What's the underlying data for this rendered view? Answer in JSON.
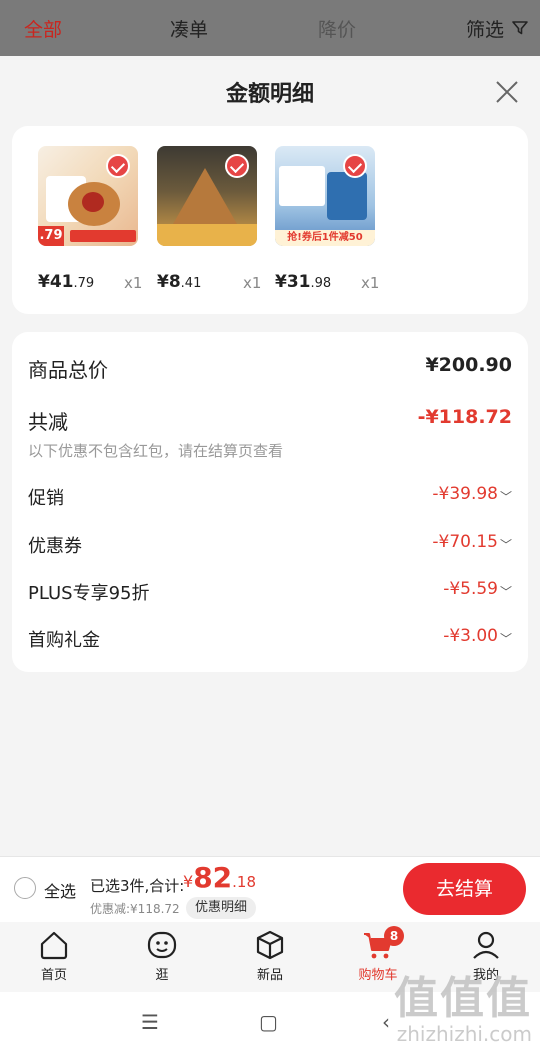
{
  "topbar": {
    "tabs": [
      "全部",
      "凑单",
      "降价",
      "筛选"
    ],
    "filter_icon": "funnel-icon"
  },
  "sheet": {
    "title": "金额明细",
    "close_icon": "close-icon"
  },
  "products": [
    {
      "price_main": "¥41",
      "price_frac": ".79",
      "qty": "x1",
      "thumb_text": ".79"
    },
    {
      "price_main": "¥8",
      "price_frac": ".41",
      "qty": "x1"
    },
    {
      "price_main": "¥31",
      "price_frac": ".98",
      "qty": "x1",
      "thumb_text": "抢!券后1件减50"
    }
  ],
  "breakdown": {
    "total_label": "商品总价",
    "total_value": "¥200.90",
    "cut_label": "共减",
    "cut_value": "-¥118.72",
    "note": "以下优惠不包含红包，请在结算页查看",
    "items": [
      {
        "label": "促销",
        "value": "-¥39.98"
      },
      {
        "label": "优惠券",
        "value": "-¥70.15"
      },
      {
        "label": "PLUS专享95折",
        "value": "-¥5.59"
      },
      {
        "label": "首购礼金",
        "value": "-¥3.00"
      }
    ]
  },
  "bottom": {
    "select_all": "全选",
    "selected_text": "已选3件,合计:",
    "sum_currency": "¥",
    "sum_int": "82",
    "sum_frac": ".18",
    "saved": "优惠减:¥118.72",
    "detail_button": "优惠明细",
    "checkout": "去结算"
  },
  "nav": {
    "items": [
      {
        "label": "首页",
        "icon": "home-icon"
      },
      {
        "label": "逛",
        "icon": "face-icon"
      },
      {
        "label": "新品",
        "icon": "box-icon"
      },
      {
        "label": "购物车",
        "icon": "cart-icon",
        "badge": "8"
      },
      {
        "label": "我的",
        "icon": "user-icon"
      }
    ]
  },
  "system": {
    "menu": "☰",
    "home": "▢",
    "back": "‹"
  },
  "watermark": {
    "big": "值值值",
    "small": "zhizhizhi.com"
  },
  "colors": {
    "accent": "#e23a2f",
    "checkout": "#ea2a2f"
  }
}
